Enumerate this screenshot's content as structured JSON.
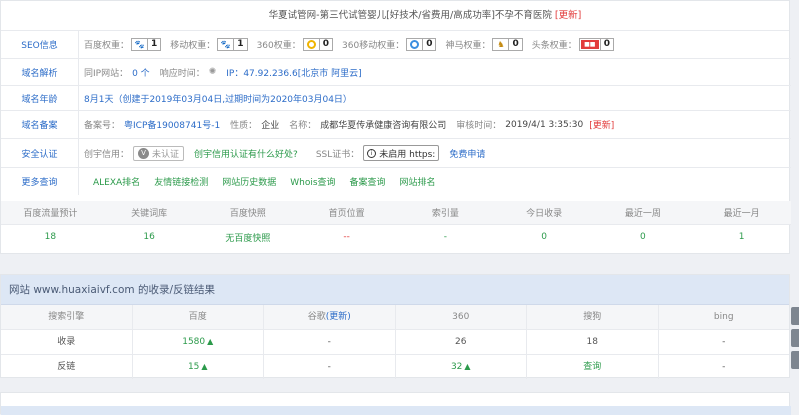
{
  "title_line": {
    "text": "华夏试管网-第三代试管婴儿[好技术/省费用/高成功率]不孕不育医院",
    "update": "[更新]"
  },
  "seo": {
    "label": "SEO信息",
    "items": [
      {
        "name": "百度权重：",
        "icon": "paw-icon",
        "value": "1"
      },
      {
        "name": "移动权重：",
        "icon": "paw-icon",
        "value": "1"
      },
      {
        "name": "360权重：",
        "icon": "360-icon",
        "value": "0"
      },
      {
        "name": "360移动权重：",
        "icon": "360-icon",
        "value": "0"
      },
      {
        "name": "神马权重：",
        "icon": "shenma-icon",
        "value": "0"
      },
      {
        "name": "头条权重：",
        "icon": "toutiao-icon",
        "value": "0"
      }
    ]
  },
  "domain": {
    "label": "域名解析",
    "same_ip": "同IP网站：",
    "same_ip_count": "0 个",
    "resp": "响应时间：",
    "ip": "IP：47.92.236.6[北京市 阿里云]"
  },
  "age": {
    "label": "域名年龄",
    "text": "8月1天（创建于2019年03月04日,过期时间为2020年03月04日）"
  },
  "beian": {
    "label": "域名备案",
    "no_label": "备案号：",
    "no": "粤ICP备19008741号-1",
    "type_label": "性质：",
    "type": "企业",
    "name_label": "名称：",
    "name": "成都华夏传承健康咨询有限公司",
    "time_label": "审核时间：",
    "time": "2019/4/1 3:35:30",
    "update": "[更新]"
  },
  "security": {
    "label": "安全认证",
    "cx_label": "创宇信用：",
    "cx_badge": "未认证",
    "cx_link": "创宇信用认证有什么好处?",
    "ssl_label": "SSL证书：",
    "ssl_badge": "未启用 https:",
    "ssl_link": "免费申请"
  },
  "more": {
    "label": "更多查询",
    "links": [
      "ALEXA排名",
      "友情链接检测",
      "网站历史数据",
      "Whois查询",
      "备案查询",
      "网站排名"
    ]
  },
  "stats": {
    "headers": [
      "百度流量预计",
      "关键词库",
      "百度快照",
      "首页位置",
      "索引量",
      "今日收录",
      "最近一周",
      "最近一月"
    ],
    "values": [
      "18",
      "16",
      "无百度快照",
      "--",
      "-",
      "0",
      "0",
      "1"
    ]
  },
  "links_panel": {
    "title": "网站 www.huaxiaivf.com 的收录/反链结果",
    "headers": [
      "搜索引擎",
      "百度",
      "谷歌",
      "(更新)",
      "360",
      "搜狗",
      "bing"
    ],
    "rows": [
      {
        "name": "收录",
        "baidu": "1580",
        "google": "-",
        "s360": "26",
        "sogou": "18",
        "bing": "-"
      },
      {
        "name": "反链",
        "baidu": "15",
        "google": "-",
        "s360": "32",
        "sogou": "查询",
        "bing": "-"
      }
    ]
  },
  "colors": {
    "link": "#2c6cc8",
    "green": "#2c9a4b",
    "red": "#e23a3a",
    "header_bg": "#dde7f5"
  }
}
